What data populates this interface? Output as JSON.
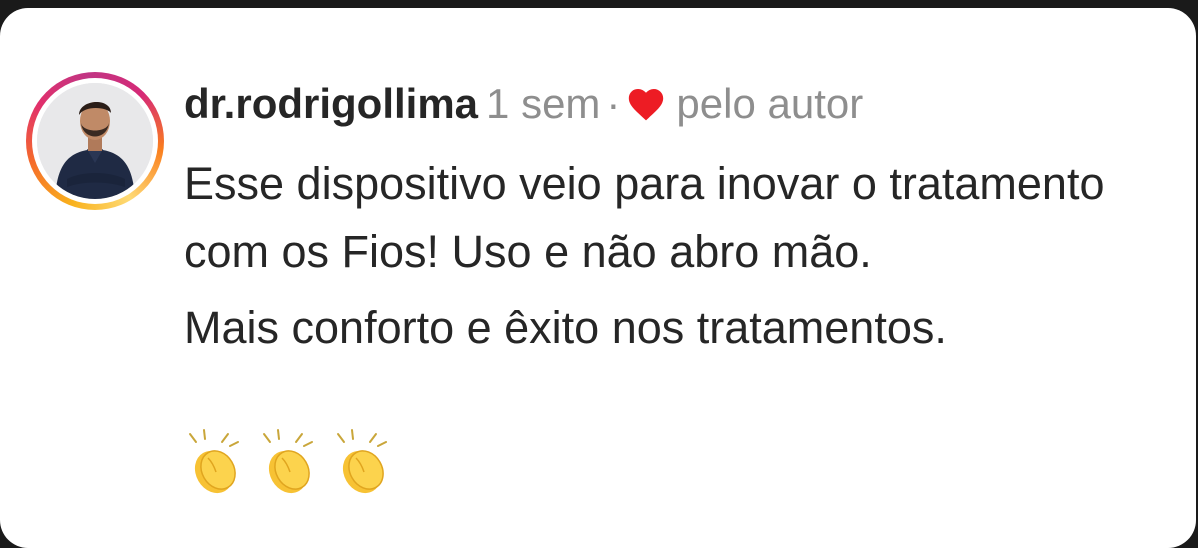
{
  "comment": {
    "username": "dr.rodrigollima",
    "time_ago": "1 sem",
    "separator": "·",
    "liked_by_author_label": "pelo autor",
    "paragraphs": [
      "Esse dispositivo veio para inovar o tratamento com os Fios! Uso e não abro mão.",
      "Mais conforto e êxito nos tratamentos."
    ],
    "emoji": [
      "clapping-hands",
      "clapping-hands",
      "clapping-hands"
    ]
  },
  "colors": {
    "background": "#ffffff",
    "text": "#262626",
    "muted": "#8e8e8e",
    "heart": "#ed1c24",
    "story_ring": [
      "#feda75",
      "#fa7e1e",
      "#d62976",
      "#962fbf"
    ]
  }
}
